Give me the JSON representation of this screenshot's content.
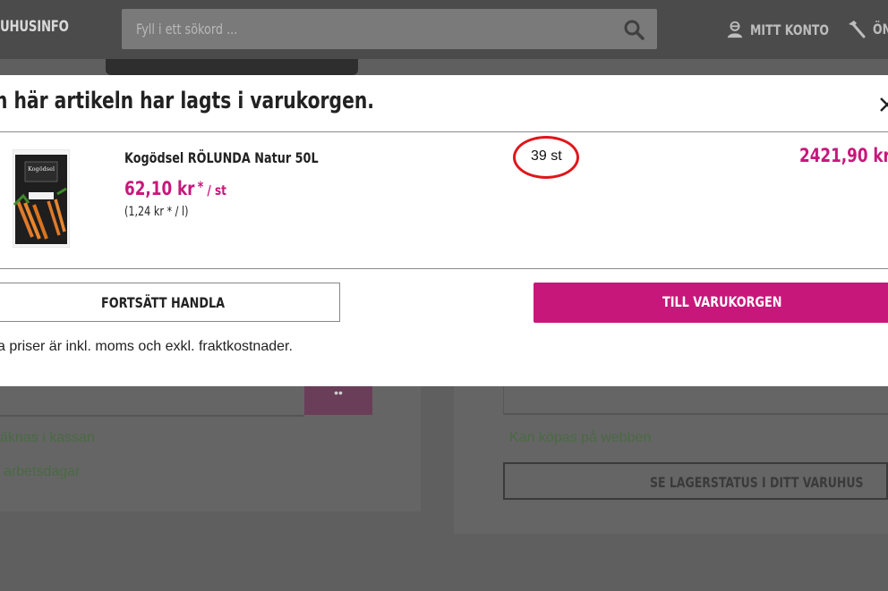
{
  "header": {
    "brand": "UHUSINFO",
    "search_placeholder": "Fyll i ett sökord ...",
    "account_label": "MITT KONTO",
    "wishlist_label": "ÖN"
  },
  "background": {
    "left_text_1": "äknas i kassan",
    "left_text_2": "arbetsdagar",
    "right_text_1": "Kan köpas på webben",
    "stock_button": "SE LAGERSTATUS I DITT VARUHUS",
    "left_button_glyph": "••"
  },
  "modal": {
    "title": "n här artikeln har lagts i varukorgen.",
    "close_glyph": "×",
    "product": {
      "name": "Kogödsel RÖLUNDA Natur 50L",
      "price": "62,10 kr",
      "price_asterisk": "*",
      "price_unit": "/ st",
      "unit_price": "(1,24 kr * / l)",
      "quantity": "39 st",
      "total": "2421,90 kr *",
      "image_label": "Kogödsel"
    },
    "continue_label": "FORTSÄTT HANDLA",
    "cart_label": "TILL VARUKORGEN",
    "note": "a priser är inkl. moms och exkl. fraktkostnader."
  },
  "colors": {
    "accent": "#c8177b",
    "highlight_circle": "#e0161b"
  }
}
